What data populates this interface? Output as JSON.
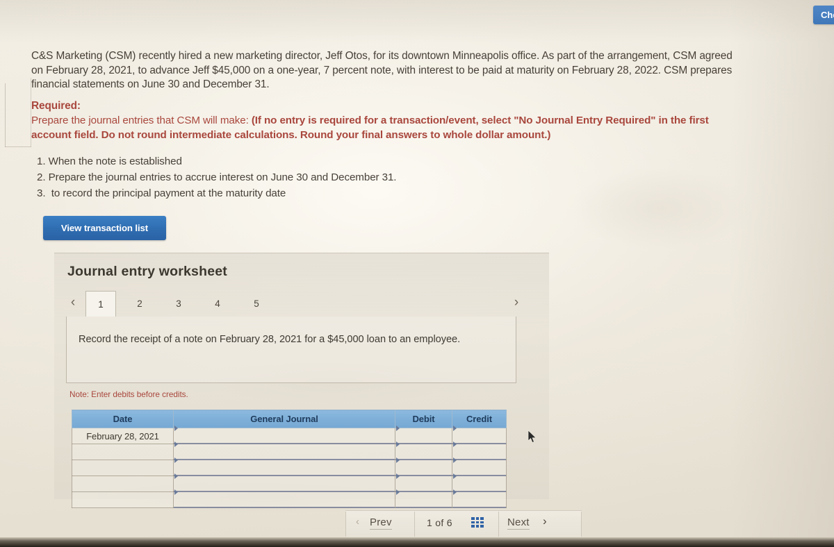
{
  "problem": {
    "text": "C&S Marketing (CSM) recently hired a new marketing director, Jeff Otos, for its downtown Minneapolis office. As part of the arrangement, CSM agreed on February 28, 2021, to advance Jeff $45,000 on a one-year, 7 percent note, with interest to be paid at maturity on February 28, 2022. CSM prepares financial statements on June 30 and December 31."
  },
  "required": {
    "label": "Required:",
    "intro": "Prepare the journal entries that CSM will make: ",
    "bold_instruction": "(If no entry is required for a transaction/event, select \"No Journal Entry Required\" in the first account field. Do not round intermediate calculations. Round your final answers to whole dollar amount.)",
    "steps": [
      "1. When the note is established",
      "2. Prepare the journal entries to accrue interest on June 30 and December 31.",
      "3.  to record the principal payment at the maturity date"
    ]
  },
  "toolbar": {
    "view_transaction_list_label": "View transaction list",
    "check_my_work_label": "Check my work"
  },
  "worksheet": {
    "title": "Journal entry worksheet",
    "tabs": [
      {
        "label": "1",
        "active": true
      },
      {
        "label": "2",
        "active": false
      },
      {
        "label": "3",
        "active": false
      },
      {
        "label": "4",
        "active": false
      },
      {
        "label": "5",
        "active": false
      }
    ],
    "prev_arrow_glyph": "‹",
    "next_arrow_glyph": "›",
    "description": "Record the receipt of a note on February 28, 2021 for a $45,000 loan to an employee.",
    "note": "Note: Enter debits before credits.",
    "table": {
      "headers": [
        "Date",
        "General Journal",
        "Debit",
        "Credit"
      ],
      "rows": [
        {
          "date": "February 28, 2021",
          "general_journal": "",
          "debit": "",
          "credit": ""
        },
        {
          "date": "",
          "general_journal": "",
          "debit": "",
          "credit": ""
        },
        {
          "date": "",
          "general_journal": "",
          "debit": "",
          "credit": ""
        },
        {
          "date": "",
          "general_journal": "",
          "debit": "",
          "credit": ""
        },
        {
          "date": "",
          "general_journal": "",
          "debit": "",
          "credit": ""
        }
      ]
    }
  },
  "navigation": {
    "prev_label": "Prev",
    "page_indicator": "1 of 6",
    "next_label": "Next",
    "prev_arrow_glyph": "‹",
    "next_arrow_glyph": "›"
  },
  "colors": {
    "primary_blue": "#2f6cb0",
    "table_header_blue": "#7eafd8",
    "required_red": "#a9473d",
    "page_background": "#efeadf",
    "body_text": "#474038"
  }
}
